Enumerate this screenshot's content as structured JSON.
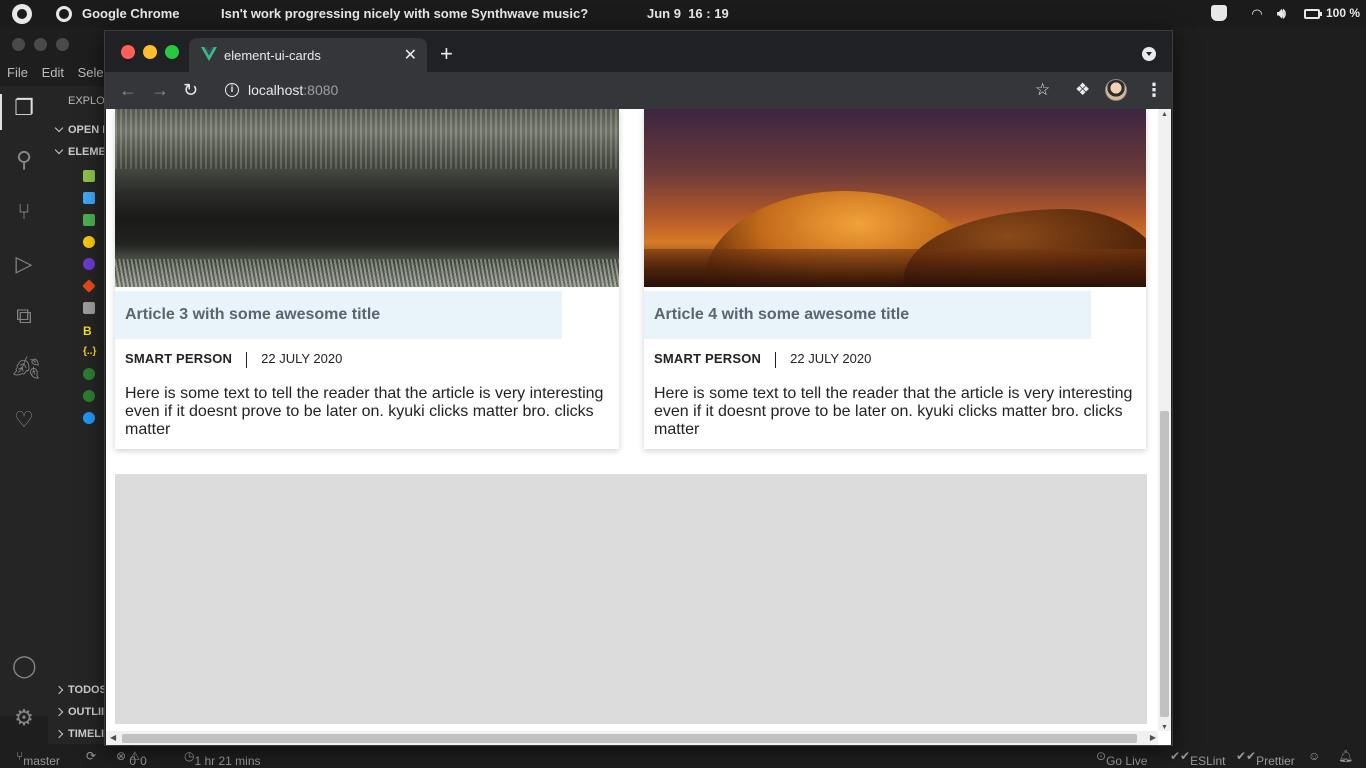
{
  "topbar": {
    "app_name": "Google Chrome",
    "song": "Isn't work progressing nicely with some Synthwave music?",
    "date": "Jun 9",
    "time": "16 : 19",
    "battery": "100 %"
  },
  "vscode": {
    "menu": [
      "File",
      "Edit",
      "Selec"
    ],
    "explorer_title": "EXPLO",
    "sections": {
      "open_editors": "OPEN I",
      "project": "ELEME",
      "todos": "TODOS",
      "outline": "OUTLII",
      "timeline": "TIMELI"
    },
    "status": {
      "branch": "master",
      "errors": "0",
      "warnings": "0",
      "time_tracked": "1 hr 21 mins",
      "go_live": "Go Live",
      "eslint": "ESLint",
      "prettier": "Prettier"
    }
  },
  "chrome": {
    "tab_title": "element-ui-cards",
    "url_host": "localhost",
    "url_port": ":8080"
  },
  "cards": [
    {
      "title": "Article 3 with some awesome title",
      "author": "SMART PERSON",
      "date": "22 JULY 2020",
      "text": "Here is some text to tell the reader that the article is very interesting even if it doesnt prove to be later on. kyuki clicks matter bro. clicks matter",
      "image": "grass-landscape"
    },
    {
      "title": "Article 4 with some awesome title",
      "author": "SMART PERSON",
      "date": "22 JULY 2020",
      "text": "Here is some text to tell the reader that the article is very interesting even if it doesnt prove to be later on. kyuki clicks matter bro. clicks matter",
      "image": "desert-dunes"
    }
  ],
  "colors": {
    "title_band": "#e8f3fa",
    "placeholder_box": "#dcdcdc",
    "vue_green": "#41b883"
  }
}
